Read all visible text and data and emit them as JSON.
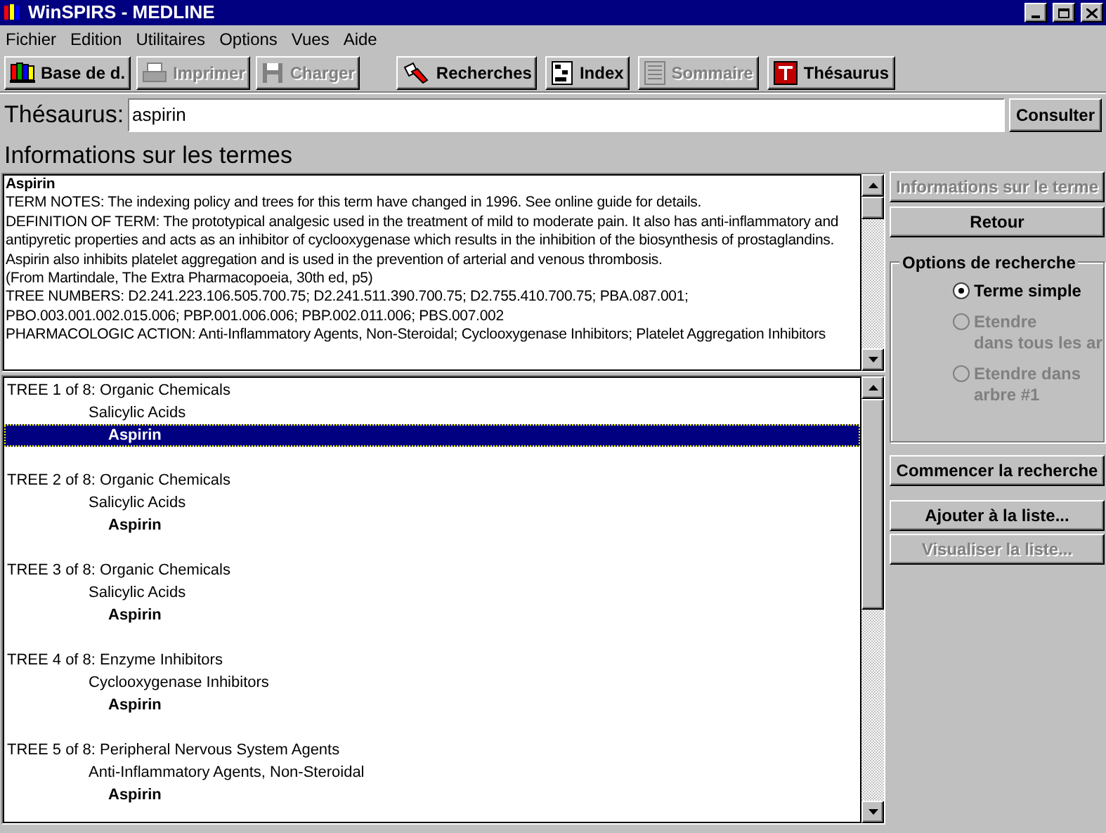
{
  "window": {
    "title": "WinSPIRS - MEDLINE"
  },
  "menu": [
    "Fichier",
    "Edition",
    "Utilitaires",
    "Options",
    "Vues",
    "Aide"
  ],
  "toolbar": [
    {
      "label": "Base de d.",
      "kind": "books",
      "disabled": false
    },
    {
      "label": "Imprimer",
      "kind": "printer",
      "disabled": true
    },
    {
      "label": "Charger",
      "kind": "disk",
      "disabled": true
    },
    {
      "label": "Recherches",
      "kind": "flashlight",
      "disabled": false
    },
    {
      "label": "Index",
      "kind": "index",
      "disabled": false
    },
    {
      "label": "Sommaire",
      "kind": "list",
      "disabled": true
    },
    {
      "label": "Thésaurus",
      "kind": "thesaurus",
      "disabled": false
    }
  ],
  "search": {
    "label": "Thésaurus:",
    "value": "aspirin",
    "button": "Consulter"
  },
  "info": {
    "heading": "Informations sur les termes",
    "title": "Aspirin",
    "paragraphs": [
      "TERM NOTES: The indexing policy and trees for this term have changed in 1996.  See online guide for details.",
      "DEFINITION OF TERM: The prototypical analgesic used in the treatment of mild to moderate pain. It also has anti-inflammatory and antipyretic properties and acts as an inhibitor of cyclooxygenase which results in the inhibition of the biosynthesis of prostaglandins. Aspirin also inhibits platelet aggregation and is used in the prevention of arterial and venous thrombosis.",
      "(From Martindale, The Extra Pharmacopoeia, 30th ed, p5)",
      "TREE NUMBERS: D2.241.223.106.505.700.75; D2.241.511.390.700.75; D2.755.410.700.75; PBA.087.001; PBO.003.001.002.015.006; PBP.001.006.006; PBP.002.011.006; PBS.007.002",
      "PHARMACOLOGIC ACTION: Anti-Inflammatory Agents, Non-Steroidal; Cyclooxygenase Inhibitors; Platelet Aggregation Inhibitors"
    ]
  },
  "trees": [
    {
      "label": "TREE 1 of 8: Organic Chemicals",
      "children": [
        {
          "label": "Salicylic Acids",
          "children": [
            {
              "label": "Aspirin",
              "selected": true
            }
          ]
        }
      ]
    },
    {
      "label": "TREE 2 of 8: Organic Chemicals",
      "children": [
        {
          "label": "Salicylic Acids",
          "children": [
            {
              "label": "Aspirin",
              "selected": false
            }
          ]
        }
      ]
    },
    {
      "label": "TREE 3 of 8: Organic Chemicals",
      "children": [
        {
          "label": "Salicylic Acids",
          "children": [
            {
              "label": "Aspirin",
              "selected": false
            }
          ]
        }
      ]
    },
    {
      "label": "TREE 4 of 8: Enzyme Inhibitors",
      "children": [
        {
          "label": "Cyclooxygenase Inhibitors",
          "children": [
            {
              "label": "Aspirin",
              "selected": false
            }
          ]
        }
      ]
    },
    {
      "label": "TREE 5 of 8: Peripheral Nervous System Agents",
      "children": [
        {
          "label": "Anti-Inflammatory Agents, Non-Steroidal",
          "children": [
            {
              "label": "Aspirin",
              "selected": false
            }
          ]
        }
      ]
    }
  ],
  "side": {
    "top_buttons": [
      {
        "label": "Informations sur le terme",
        "disabled": true
      },
      {
        "label": "Retour",
        "disabled": false
      }
    ],
    "options": {
      "title": "Options de recherche",
      "items": [
        {
          "lines": [
            "Terme simple"
          ],
          "selected": true,
          "disabled": false
        },
        {
          "lines": [
            "Etendre",
            "dans tous les ar"
          ],
          "selected": false,
          "disabled": true
        },
        {
          "lines": [
            "Etendre dans",
            "arbre #1"
          ],
          "selected": false,
          "disabled": true
        }
      ]
    },
    "start": {
      "label": "Commencer la recherche",
      "disabled": false
    },
    "list_buttons": [
      {
        "label": "Ajouter à la liste...",
        "disabled": false
      },
      {
        "label": "Visualiser la liste...",
        "disabled": true
      }
    ]
  }
}
